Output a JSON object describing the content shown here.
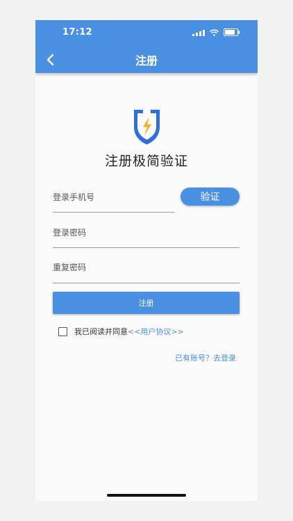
{
  "status_bar": {
    "time": "17:12",
    "battery_level": 0.8
  },
  "header": {
    "title": "注册"
  },
  "app": {
    "title": "注册极简验证"
  },
  "form": {
    "phone_label": "登录手机号",
    "verify_label": "验证",
    "password_label": "登录密码",
    "repeat_password_label": "重复密码",
    "submit_label": "注册"
  },
  "agreement": {
    "prefix": "我已阅读并同意",
    "link": "<<用户协议>>",
    "checked": false
  },
  "login_link": "已有账号？去登录",
  "colors": {
    "primary": "#4a90e2",
    "accent": "#f5b21f",
    "background": "#fafafa"
  }
}
